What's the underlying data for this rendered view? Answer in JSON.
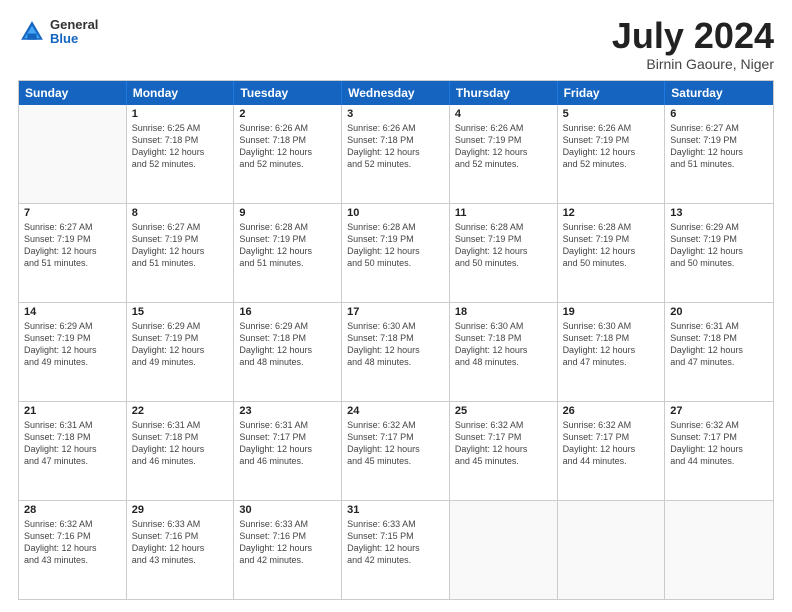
{
  "header": {
    "logo": {
      "general": "General",
      "blue": "Blue"
    },
    "title": "July 2024",
    "location": "Birnin Gaoure, Niger"
  },
  "weekdays": [
    "Sunday",
    "Monday",
    "Tuesday",
    "Wednesday",
    "Thursday",
    "Friday",
    "Saturday"
  ],
  "weeks": [
    [
      {
        "num": "",
        "info": "",
        "empty": true
      },
      {
        "num": "1",
        "info": "Sunrise: 6:25 AM\nSunset: 7:18 PM\nDaylight: 12 hours\nand 52 minutes."
      },
      {
        "num": "2",
        "info": "Sunrise: 6:26 AM\nSunset: 7:18 PM\nDaylight: 12 hours\nand 52 minutes."
      },
      {
        "num": "3",
        "info": "Sunrise: 6:26 AM\nSunset: 7:18 PM\nDaylight: 12 hours\nand 52 minutes."
      },
      {
        "num": "4",
        "info": "Sunrise: 6:26 AM\nSunset: 7:19 PM\nDaylight: 12 hours\nand 52 minutes."
      },
      {
        "num": "5",
        "info": "Sunrise: 6:26 AM\nSunset: 7:19 PM\nDaylight: 12 hours\nand 52 minutes."
      },
      {
        "num": "6",
        "info": "Sunrise: 6:27 AM\nSunset: 7:19 PM\nDaylight: 12 hours\nand 51 minutes."
      }
    ],
    [
      {
        "num": "7",
        "info": "Sunrise: 6:27 AM\nSunset: 7:19 PM\nDaylight: 12 hours\nand 51 minutes."
      },
      {
        "num": "8",
        "info": "Sunrise: 6:27 AM\nSunset: 7:19 PM\nDaylight: 12 hours\nand 51 minutes."
      },
      {
        "num": "9",
        "info": "Sunrise: 6:28 AM\nSunset: 7:19 PM\nDaylight: 12 hours\nand 51 minutes."
      },
      {
        "num": "10",
        "info": "Sunrise: 6:28 AM\nSunset: 7:19 PM\nDaylight: 12 hours\nand 50 minutes."
      },
      {
        "num": "11",
        "info": "Sunrise: 6:28 AM\nSunset: 7:19 PM\nDaylight: 12 hours\nand 50 minutes."
      },
      {
        "num": "12",
        "info": "Sunrise: 6:28 AM\nSunset: 7:19 PM\nDaylight: 12 hours\nand 50 minutes."
      },
      {
        "num": "13",
        "info": "Sunrise: 6:29 AM\nSunset: 7:19 PM\nDaylight: 12 hours\nand 50 minutes."
      }
    ],
    [
      {
        "num": "14",
        "info": "Sunrise: 6:29 AM\nSunset: 7:19 PM\nDaylight: 12 hours\nand 49 minutes."
      },
      {
        "num": "15",
        "info": "Sunrise: 6:29 AM\nSunset: 7:19 PM\nDaylight: 12 hours\nand 49 minutes."
      },
      {
        "num": "16",
        "info": "Sunrise: 6:29 AM\nSunset: 7:18 PM\nDaylight: 12 hours\nand 48 minutes."
      },
      {
        "num": "17",
        "info": "Sunrise: 6:30 AM\nSunset: 7:18 PM\nDaylight: 12 hours\nand 48 minutes."
      },
      {
        "num": "18",
        "info": "Sunrise: 6:30 AM\nSunset: 7:18 PM\nDaylight: 12 hours\nand 48 minutes."
      },
      {
        "num": "19",
        "info": "Sunrise: 6:30 AM\nSunset: 7:18 PM\nDaylight: 12 hours\nand 47 minutes."
      },
      {
        "num": "20",
        "info": "Sunrise: 6:31 AM\nSunset: 7:18 PM\nDaylight: 12 hours\nand 47 minutes."
      }
    ],
    [
      {
        "num": "21",
        "info": "Sunrise: 6:31 AM\nSunset: 7:18 PM\nDaylight: 12 hours\nand 47 minutes."
      },
      {
        "num": "22",
        "info": "Sunrise: 6:31 AM\nSunset: 7:18 PM\nDaylight: 12 hours\nand 46 minutes."
      },
      {
        "num": "23",
        "info": "Sunrise: 6:31 AM\nSunset: 7:17 PM\nDaylight: 12 hours\nand 46 minutes."
      },
      {
        "num": "24",
        "info": "Sunrise: 6:32 AM\nSunset: 7:17 PM\nDaylight: 12 hours\nand 45 minutes."
      },
      {
        "num": "25",
        "info": "Sunrise: 6:32 AM\nSunset: 7:17 PM\nDaylight: 12 hours\nand 45 minutes."
      },
      {
        "num": "26",
        "info": "Sunrise: 6:32 AM\nSunset: 7:17 PM\nDaylight: 12 hours\nand 44 minutes."
      },
      {
        "num": "27",
        "info": "Sunrise: 6:32 AM\nSunset: 7:17 PM\nDaylight: 12 hours\nand 44 minutes."
      }
    ],
    [
      {
        "num": "28",
        "info": "Sunrise: 6:32 AM\nSunset: 7:16 PM\nDaylight: 12 hours\nand 43 minutes."
      },
      {
        "num": "29",
        "info": "Sunrise: 6:33 AM\nSunset: 7:16 PM\nDaylight: 12 hours\nand 43 minutes."
      },
      {
        "num": "30",
        "info": "Sunrise: 6:33 AM\nSunset: 7:16 PM\nDaylight: 12 hours\nand 42 minutes."
      },
      {
        "num": "31",
        "info": "Sunrise: 6:33 AM\nSunset: 7:15 PM\nDaylight: 12 hours\nand 42 minutes."
      },
      {
        "num": "",
        "info": "",
        "empty": true
      },
      {
        "num": "",
        "info": "",
        "empty": true
      },
      {
        "num": "",
        "info": "",
        "empty": true
      }
    ]
  ]
}
